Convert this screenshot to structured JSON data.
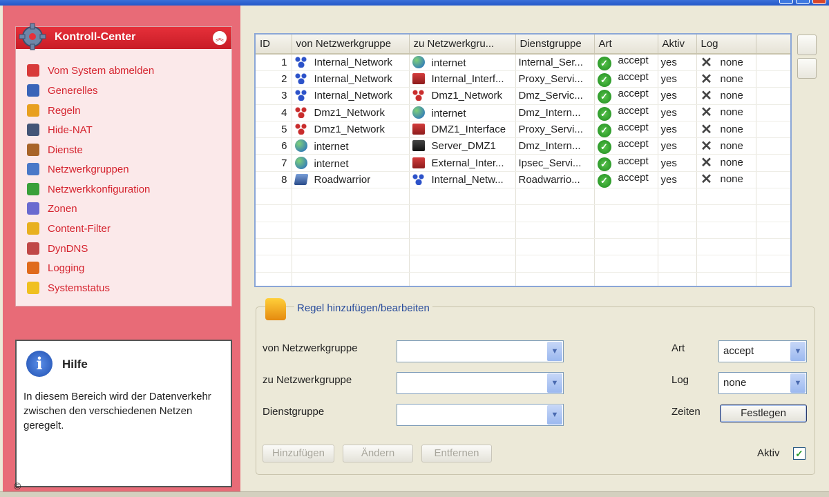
{
  "sidebar": {
    "header": "Kontroll-Center",
    "items": [
      {
        "label": "Vom System abmelden",
        "icon": "power-icon",
        "color": "#d83a3a"
      },
      {
        "label": "Generelles",
        "icon": "window-icon",
        "color": "#3a64b8"
      },
      {
        "label": "Regeln",
        "icon": "rules-icon",
        "color": "#e8a020"
      },
      {
        "label": "Hide-NAT",
        "icon": "nat-icon",
        "color": "#445577"
      },
      {
        "label": "Dienste",
        "icon": "box-icon",
        "color": "#a8642a"
      },
      {
        "label": "Netzwerkgruppen",
        "icon": "network-group-icon",
        "color": "#4a78c8"
      },
      {
        "label": "Netzwerkkonfiguration",
        "icon": "network-config-icon",
        "color": "#3aa03a"
      },
      {
        "label": "Zonen",
        "icon": "zones-icon",
        "color": "#6a6ad0"
      },
      {
        "label": "Content-Filter",
        "icon": "filter-icon",
        "color": "#e8b020"
      },
      {
        "label": "DynDNS",
        "icon": "dyndns-icon",
        "color": "#c04848"
      },
      {
        "label": "Logging",
        "icon": "logging-icon",
        "color": "#e06a1c"
      },
      {
        "label": "Systemstatus",
        "icon": "bulb-icon",
        "color": "#f0c020"
      }
    ]
  },
  "help": {
    "title": "Hilfe",
    "text": "In diesem Bereich wird der Datenverkehr zwischen den verschiedenen Netzen geregelt."
  },
  "copyright": "©",
  "table": {
    "columns": [
      "ID",
      "von Netzwerkgruppe",
      "zu Netzwerkgru...",
      "Dienstgruppe",
      "Art",
      "Aktiv",
      "Log"
    ],
    "rows": [
      {
        "id": "1",
        "from": "Internal_Network",
        "from_icon": "net",
        "to": "internet",
        "to_icon": "globe",
        "service": "Internal_Ser...",
        "art": "accept",
        "aktiv": "yes",
        "log": "none"
      },
      {
        "id": "2",
        "from": "Internal_Network",
        "from_icon": "net",
        "to": "Internal_Interf...",
        "to_icon": "iface",
        "service": "Proxy_Servi...",
        "art": "accept",
        "aktiv": "yes",
        "log": "none"
      },
      {
        "id": "3",
        "from": "Internal_Network",
        "from_icon": "net",
        "to": "Dmz1_Network",
        "to_icon": "net red",
        "service": "Dmz_Servic...",
        "art": "accept",
        "aktiv": "yes",
        "log": "none"
      },
      {
        "id": "4",
        "from": "Dmz1_Network",
        "from_icon": "net red",
        "to": "internet",
        "to_icon": "globe",
        "service": "Dmz_Intern...",
        "art": "accept",
        "aktiv": "yes",
        "log": "none"
      },
      {
        "id": "5",
        "from": "Dmz1_Network",
        "from_icon": "net red",
        "to": "DMZ1_Interface",
        "to_icon": "iface",
        "service": "Proxy_Servi...",
        "art": "accept",
        "aktiv": "yes",
        "log": "none"
      },
      {
        "id": "6",
        "from": "internet",
        "from_icon": "globe",
        "to": "Server_DMZ1",
        "to_icon": "server",
        "service": "Dmz_Intern...",
        "art": "accept",
        "aktiv": "yes",
        "log": "none"
      },
      {
        "id": "7",
        "from": "internet",
        "from_icon": "globe",
        "to": "External_Inter...",
        "to_icon": "iface",
        "service": "Ipsec_Servi...",
        "art": "accept",
        "aktiv": "yes",
        "log": "none"
      },
      {
        "id": "8",
        "from": "Roadwarrior",
        "from_icon": "laptop",
        "to": "Internal_Netw...",
        "to_icon": "net",
        "service": "Roadwarrio...",
        "art": "accept",
        "aktiv": "yes",
        "log": "none"
      }
    ]
  },
  "form": {
    "title": "Regel hinzufügen/bearbeiten",
    "from_label": "von Netzwerkgruppe",
    "to_label": "zu Netzwerkgruppe",
    "service_label": "Dienstgruppe",
    "art_label": "Art",
    "art_value": "accept",
    "log_label": "Log",
    "log_value": "none",
    "zeiten_label": "Zeiten",
    "festlegen_button": "Festlegen",
    "add_button": "Hinzufügen",
    "change_button": "Ändern",
    "remove_button": "Entfernen",
    "aktiv_label": "Aktiv",
    "aktiv_checked": true
  }
}
